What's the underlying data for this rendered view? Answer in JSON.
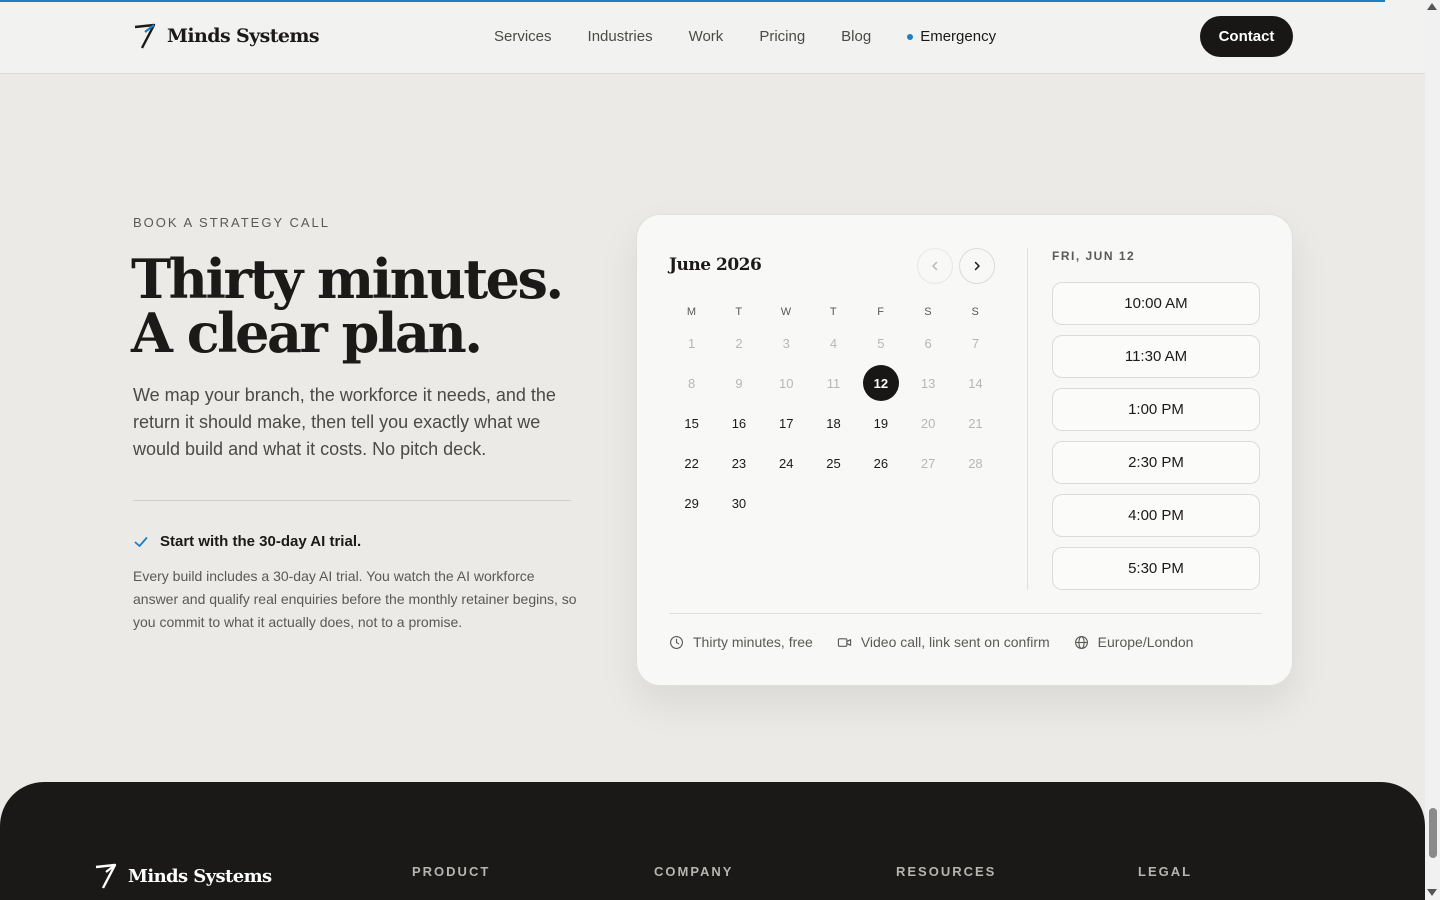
{
  "header": {
    "brand": "Minds Systems",
    "nav": [
      "Services",
      "Industries",
      "Work",
      "Pricing",
      "Blog"
    ],
    "emergency": "Emergency",
    "contact": "Contact"
  },
  "hero": {
    "eyebrow": "BOOK A STRATEGY CALL",
    "headline_line1": "Thirty minutes.",
    "headline_line2": "A clear plan.",
    "lede": "We map your branch, the workforce it needs, and the return it should make, then tell you exactly what we would build and what it costs. No pitch deck.",
    "trial_title": "Start with the 30-day AI trial.",
    "trial_body": "Every build includes a 30-day AI trial. You watch the AI workforce answer and qualify real enquiries before the monthly retainer begins, so you commit to what it actually does, not to a promise."
  },
  "calendar": {
    "month": "June 2026",
    "weekdays": [
      "M",
      "T",
      "W",
      "T",
      "F",
      "S",
      "S"
    ],
    "weeks": [
      [
        "1",
        "2",
        "3",
        "4",
        "5",
        "6",
        "7"
      ],
      [
        "8",
        "9",
        "10",
        "11",
        "12",
        "13",
        "14"
      ],
      [
        "15",
        "16",
        "17",
        "18",
        "19",
        "20",
        "21"
      ],
      [
        "22",
        "23",
        "24",
        "25",
        "26",
        "27",
        "28"
      ],
      [
        "29",
        "30",
        "",
        "",
        "",
        "",
        ""
      ]
    ],
    "selected": "12",
    "selected_label": "FRI, JUN 12",
    "slots": [
      "10:00 AM",
      "11:30 AM",
      "1:00 PM",
      "2:30 PM",
      "4:00 PM",
      "5:30 PM"
    ],
    "meta": {
      "duration": "Thirty minutes, free",
      "format": "Video call, link sent on confirm",
      "timezone": "Europe/London"
    }
  },
  "footer": {
    "brand": "Minds Systems",
    "columns": [
      "PRODUCT",
      "COMPANY",
      "RESOURCES",
      "LEGAL"
    ]
  },
  "colors": {
    "accent": "#1e7fc4",
    "dark": "#181716",
    "background": "#ebeae7"
  }
}
